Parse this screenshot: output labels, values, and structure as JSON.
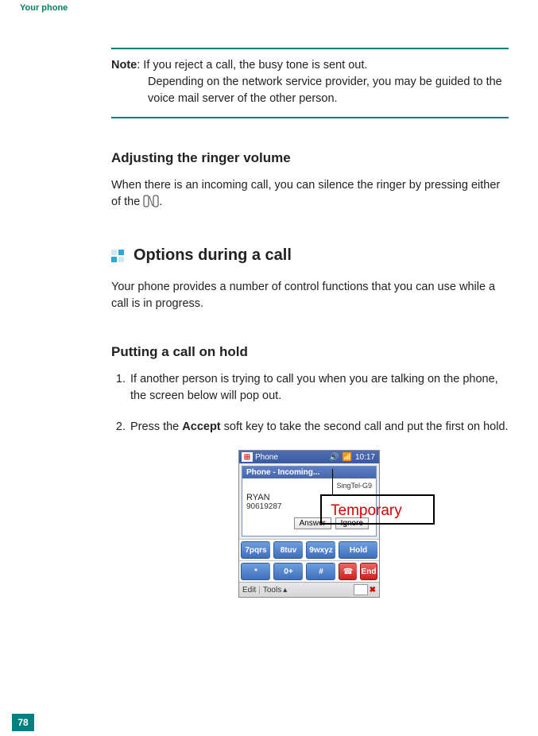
{
  "page": {
    "header_label": "Your phone",
    "page_number": "78"
  },
  "note": {
    "label": "Note",
    "line1": ": If you reject a call, the busy tone is sent out.",
    "line2": "Depending on the network service provider, you may be guided to the voice mail server of the other person."
  },
  "sections": {
    "adjust_title": "Adjusting the ringer volume",
    "adjust_body_a": "When there is an incoming call, you can silence the ringer by pressing either of the ",
    "adjust_body_b": ".",
    "options_title": "Options during a call",
    "options_body": "Your phone provides a number of control functions that you can use while a call is in progress.",
    "hold_title": "Putting a call on hold",
    "step1": "If another person is trying to call you when you are talking on the phone, the screen below will pop out.",
    "step2_a": "Press the ",
    "step2_bold": "Accept",
    "step2_b": " soft key to take the second call and put the first on hold."
  },
  "phone": {
    "status_app": "Phone",
    "status_time": "10:17",
    "popup_title": "Phone - Incoming...",
    "carrier": "SingTel-G9",
    "caller_name": "RYAN",
    "caller_number": "90619287",
    "btn_answer": "Answer",
    "btn_ignore": "Ignore",
    "key_7": "7pqrs",
    "key_8": "8tuv",
    "key_9": "9wxyz",
    "key_hold": "Hold",
    "key_star": "*",
    "key_0": "0+",
    "key_hash": "#",
    "key_end": "End",
    "bottom_edit": "Edit",
    "bottom_tools": "Tools"
  },
  "overlay": {
    "temporary_label": "Temporary"
  }
}
